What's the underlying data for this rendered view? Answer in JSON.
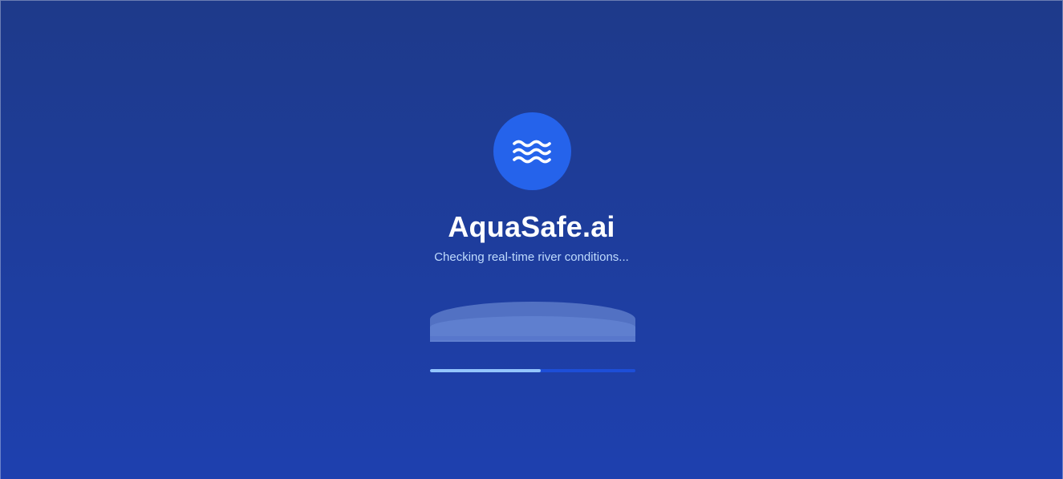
{
  "loader": {
    "logo_icon": "waves-icon",
    "title": "AquaSafe.ai",
    "status": "Checking real-time river conditions...",
    "progress": 0.54
  },
  "colors": {
    "background_top": "#1e3a8a",
    "background_bottom": "#1e40af",
    "logo_circle": "#2563eb",
    "progress_track": "#1d4ed8",
    "progress_fill": "#93c5fd",
    "status_text": "#bfdbfe"
  }
}
